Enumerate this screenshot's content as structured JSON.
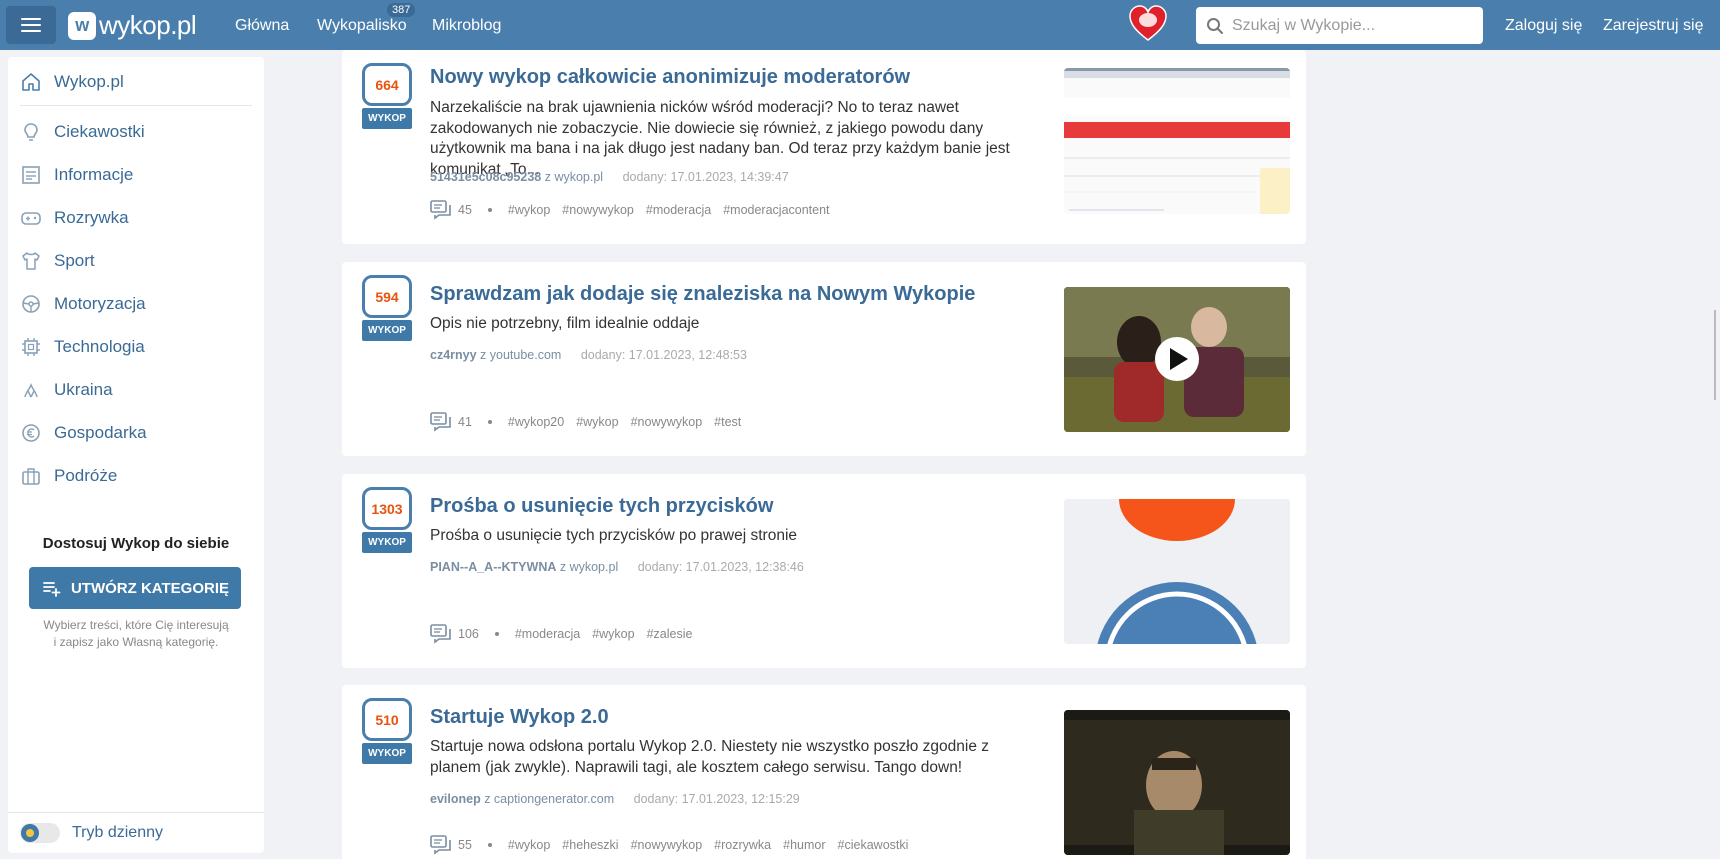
{
  "topbar": {
    "logo": "wykop.pl",
    "nav": [
      "Główna",
      "Wykopalisko",
      "Mikroblog"
    ],
    "wykopalisko_badge": "387",
    "search_placeholder": "Szukaj w Wykopie...",
    "login": "Zaloguj się",
    "register": "Zarejestruj się"
  },
  "sidebar": {
    "home": "Wykop.pl",
    "items": [
      {
        "label": "Ciekawostki",
        "icon": "lightbulb-icon"
      },
      {
        "label": "Informacje",
        "icon": "newspaper-icon"
      },
      {
        "label": "Rozrywka",
        "icon": "gamepad-icon"
      },
      {
        "label": "Sport",
        "icon": "shirt-icon"
      },
      {
        "label": "Motoryzacja",
        "icon": "steering-wheel-icon"
      },
      {
        "label": "Technologia",
        "icon": "chip-icon"
      },
      {
        "label": "Ukraina",
        "icon": "ukraine-icon"
      },
      {
        "label": "Gospodarka",
        "icon": "coin-icon"
      },
      {
        "label": "Podróże",
        "icon": "suitcase-icon"
      }
    ],
    "custom_title": "Dostosuj Wykop do siebie",
    "create_button": "UTWÓRZ KATEGORIĘ",
    "note_line1": "Wybierz treści, które Cię interesują",
    "note_line2": "i zapisz jako Własną kategorię.",
    "toggle_label": "Tryb dzienny"
  },
  "vote_label": "WYKOP",
  "posts": [
    {
      "votes": "664",
      "title": "Nowy wykop całkowicie anonimizuje moderatorów",
      "description": "Narzekaliście na brak ujawnienia nicków wśród moderacji? No to teraz nawet zakodowanych nie zobaczycie. Nie dowiecie się również, z jakiego powodu dany użytkownik ma bana i na jak długo jest nadany ban. Od teraz przy każdym banie jest komunikat „To...",
      "author": "51431e5c08c95238",
      "source": "z wykop.pl",
      "date": "dodany: 17.01.2023, 14:39:47",
      "comments": "45",
      "tags": [
        "#wykop",
        "#nowywykop",
        "#moderacja",
        "#moderacjacontent"
      ]
    },
    {
      "votes": "594",
      "title": "Sprawdzam jak dodaje się znaleziska na Nowym Wykopie",
      "description": "Opis nie potrzebny, film idealnie oddaje",
      "author": "cz4rnyy",
      "source": "z youtube.com",
      "date": "dodany: 17.01.2023, 12:48:53",
      "comments": "41",
      "tags": [
        "#wykop20",
        "#wykop",
        "#nowywykop",
        "#test"
      ]
    },
    {
      "votes": "1303",
      "title": "Prośba o usunięcie tych przycisków",
      "description": "Prośba o usunięcie tych przycisków po prawej stronie",
      "author": "PIAN--A_A--KTYWNA",
      "source": "z wykop.pl",
      "date": "dodany: 17.01.2023, 12:38:46",
      "comments": "106",
      "tags": [
        "#moderacja",
        "#wykop",
        "#zalesie"
      ]
    },
    {
      "votes": "510",
      "title": "Startuje Wykop 2.0",
      "description": "Startuje nowa odsłona portalu Wykop 2.0. Niestety nie wszystko poszło zgodnie z planem (jak zwykle). Naprawili tagi, ale kosztem całego serwisu. Tango down!",
      "author": "evilonep",
      "source": "z captiongenerator.com",
      "date": "dodany: 17.01.2023, 12:15:29",
      "comments": "55",
      "tags": [
        "#wykop",
        "#heheszki",
        "#nowywykop",
        "#rozrywka",
        "#humor",
        "#ciekawostki"
      ]
    }
  ]
}
